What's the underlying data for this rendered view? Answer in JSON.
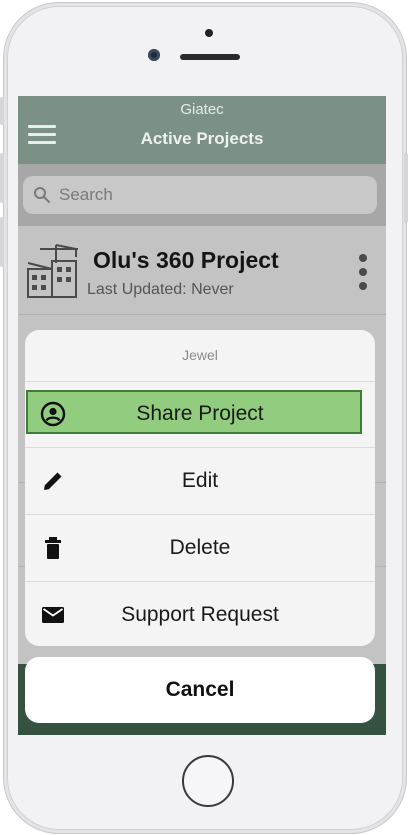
{
  "header": {
    "subtitle": "Giatec",
    "title": "Active Projects"
  },
  "search": {
    "placeholder": "Search"
  },
  "project": {
    "name": "Olu's 360 Project",
    "last_updated": "Last Updated: Never"
  },
  "action_sheet": {
    "title": "Jewel",
    "actions": [
      {
        "label": "Share Project",
        "icon": "account-circle-icon",
        "highlighted": true,
        "highlight_color": "#92cd7f",
        "highlight_border": "#3e7d37"
      },
      {
        "label": "Edit",
        "icon": "pencil-icon"
      },
      {
        "label": "Delete",
        "icon": "trash-icon"
      },
      {
        "label": "Support Request",
        "icon": "mail-icon"
      }
    ],
    "cancel_label": "Cancel"
  },
  "colors": {
    "nav_bar": "#35513f",
    "overlay_dim": "rgba(0,0,0,0.35)"
  }
}
